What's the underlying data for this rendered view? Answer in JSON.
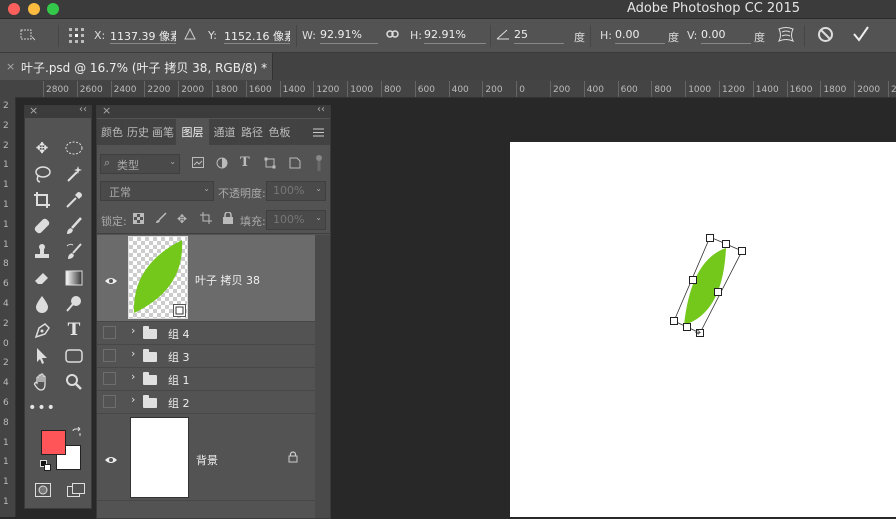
{
  "app": {
    "title": "Adobe Photoshop CC 2015"
  },
  "options": {
    "x_label": "X:",
    "x_value": "1137.39 像素",
    "y_label": "Y:",
    "y_value": "1152.16 像素",
    "w_label": "W:",
    "w_value": "92.91%",
    "h_label": "H:",
    "h_value": "92.91%",
    "angle_value": "25",
    "angle_unit": "度",
    "hskew_label": "H:",
    "hskew_value": "0.00",
    "hskew_unit": "度",
    "vskew_label": "V:",
    "vskew_value": "0.00",
    "vskew_unit": "度"
  },
  "document": {
    "tab_title": "叶子.psd @ 16.7% (叶子 拷贝 38, RGB/8) *",
    "close_glyph": "×"
  },
  "ruler": {
    "ticks": [
      "2800",
      "2600",
      "2400",
      "2200",
      "2000",
      "1800",
      "1600",
      "1400",
      "1200",
      "1000",
      "800",
      "600",
      "400",
      "200",
      "0",
      "200",
      "400",
      "600",
      "800",
      "1000",
      "1200",
      "1400",
      "1600",
      "1800",
      "2000",
      "2200"
    ]
  },
  "vruler": {
    "ticks": [
      "2",
      "2",
      "2",
      "1",
      "1",
      "1",
      "1",
      "1",
      "8",
      "6",
      "4",
      "2",
      "0",
      "2",
      "4",
      "6",
      "8",
      "1",
      "1",
      "1",
      "1"
    ]
  },
  "layers_panel": {
    "tabs": [
      "颜色",
      "历史",
      "画笔",
      "图层",
      "通道",
      "路径",
      "色板"
    ],
    "active_tab": "图层",
    "filter_label": "类型",
    "blend_mode": "正常",
    "opacity_label": "不透明度:",
    "opacity_value": "100%",
    "lock_label": "锁定:",
    "fill_label": "填充:",
    "fill_value": "100%",
    "layers": [
      {
        "name": "叶子 拷贝 38",
        "selected": true
      },
      {
        "name": "组 4"
      },
      {
        "name": "组 3"
      },
      {
        "name": "组 1"
      },
      {
        "name": "组 2"
      },
      {
        "name": "背景"
      }
    ]
  },
  "colors": {
    "foreground": "#ff5558",
    "background": "#ffffff",
    "leaf": "#74c81c"
  }
}
